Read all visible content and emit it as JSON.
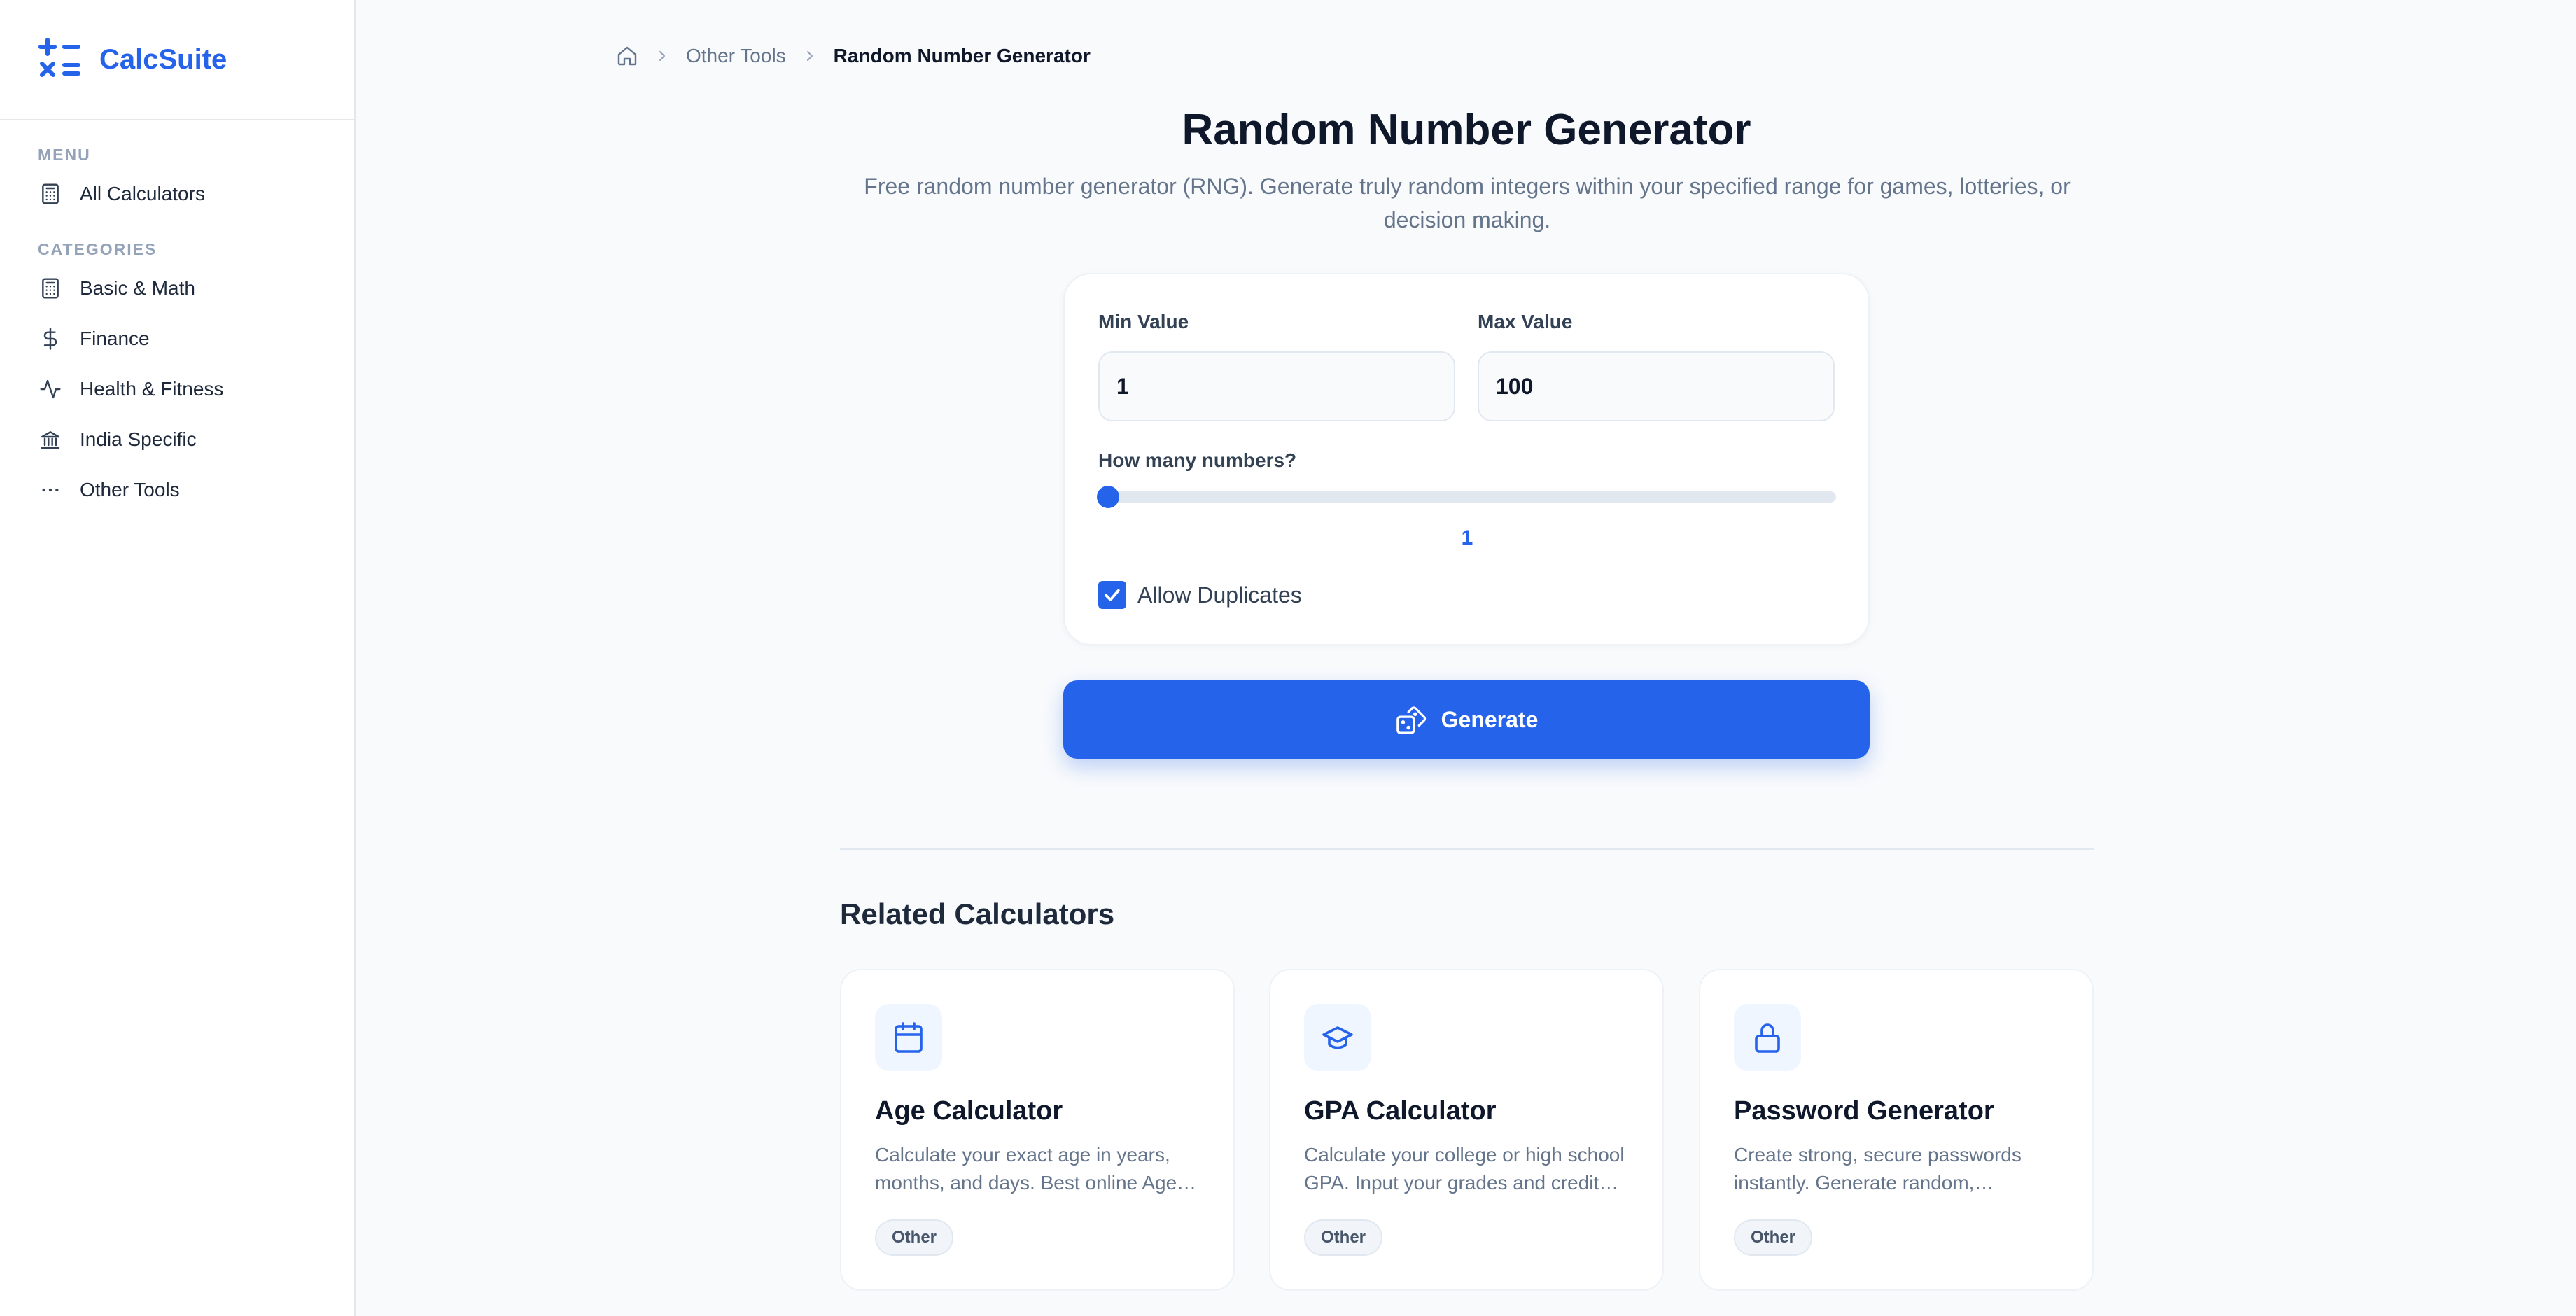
{
  "brand": {
    "name": "CalcSuite"
  },
  "sidebar": {
    "menu_label": "MENU",
    "menu_items": [
      {
        "label": "All Calculators",
        "icon": "calculator-icon"
      }
    ],
    "categories_label": "CATEGORIES",
    "categories": [
      {
        "label": "Basic & Math",
        "icon": "calculator-icon"
      },
      {
        "label": "Finance",
        "icon": "dollar-icon"
      },
      {
        "label": "Health & Fitness",
        "icon": "activity-icon"
      },
      {
        "label": "India Specific",
        "icon": "bank-icon"
      },
      {
        "label": "Other Tools",
        "icon": "more-horizontal-icon"
      }
    ]
  },
  "breadcrumb": {
    "parent": "Other Tools",
    "current": "Random Number Generator"
  },
  "page": {
    "title": "Random Number Generator",
    "description": "Free random number generator (RNG). Generate truly random integers within your specified range for games, lotteries, or decision making."
  },
  "form": {
    "min_label": "Min Value",
    "min_value": "1",
    "max_label": "Max Value",
    "max_value": "100",
    "count_label": "How many numbers?",
    "count_value": "1",
    "allow_duplicates_label": "Allow Duplicates",
    "allow_duplicates_checked": true
  },
  "generate_button": {
    "label": "Generate"
  },
  "related": {
    "title": "Related Calculators",
    "cards": [
      {
        "name": "Age Calculator",
        "description": "Calculate your exact age in years, months, and days. Best online Age…",
        "badge": "Other",
        "icon": "calendar-icon"
      },
      {
        "name": "GPA Calculator",
        "description": "Calculate your college or high school GPA. Input your grades and credit…",
        "badge": "Other",
        "icon": "graduation-cap-icon"
      },
      {
        "name": "Password Generator",
        "description": "Create strong, secure passwords instantly. Generate random,…",
        "badge": "Other",
        "icon": "lock-icon"
      }
    ]
  },
  "colors": {
    "accent": "#2563eb",
    "text": "#0f172a",
    "muted": "#64748b",
    "background": "#f8fafc"
  }
}
